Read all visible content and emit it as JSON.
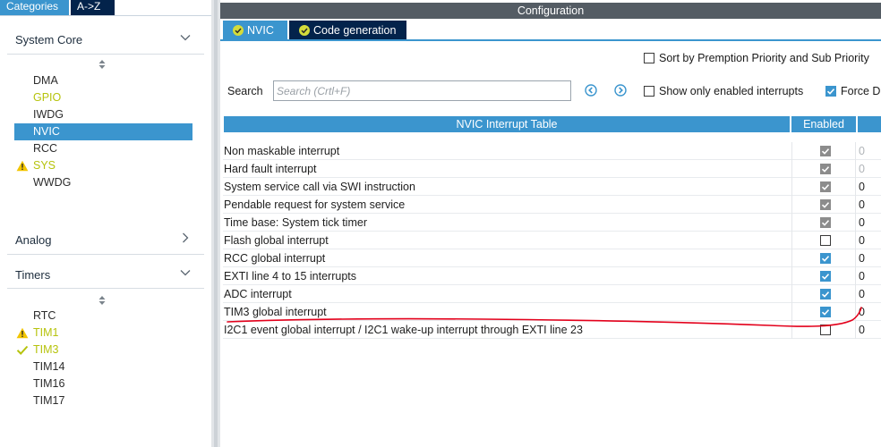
{
  "sidebar": {
    "tabs": {
      "categories": "Categories",
      "az": "A->Z"
    },
    "sections": {
      "system_core": "System Core",
      "analog": "Analog",
      "timers": "Timers"
    },
    "system_core_items": [
      {
        "label": "DMA",
        "state": "none"
      },
      {
        "label": "GPIO",
        "state": "configured"
      },
      {
        "label": "IWDG",
        "state": "none"
      },
      {
        "label": "NVIC",
        "state": "selected"
      },
      {
        "label": "RCC",
        "state": "none"
      },
      {
        "label": "SYS",
        "state": "warning"
      },
      {
        "label": "WWDG",
        "state": "none"
      }
    ],
    "timer_items": [
      {
        "label": "RTC",
        "state": "none"
      },
      {
        "label": "TIM1",
        "state": "warning"
      },
      {
        "label": "TIM3",
        "state": "ok"
      },
      {
        "label": "TIM14",
        "state": "none"
      },
      {
        "label": "TIM16",
        "state": "none"
      },
      {
        "label": "TIM17",
        "state": "none"
      }
    ]
  },
  "main": {
    "title": "Configuration",
    "tabs": {
      "nvic": "NVIC",
      "code_generation": "Code generation"
    },
    "options": {
      "sort_label": "Sort by Premption Priority and Sub Priority",
      "show_enabled_label": "Show only enabled interrupts",
      "force_label": "Force D"
    },
    "search": {
      "label": "Search",
      "placeholder": "Search (Crtl+F)"
    },
    "table": {
      "col_name": "NVIC Interrupt Table",
      "col_enabled": "Enabled",
      "rows": [
        {
          "name": "Non maskable interrupt",
          "enabled": "locked",
          "priority": "0",
          "dim": true
        },
        {
          "name": "Hard fault interrupt",
          "enabled": "locked",
          "priority": "0",
          "dim": true
        },
        {
          "name": "System service call via SWI instruction",
          "enabled": "locked",
          "priority": "0",
          "dim": false
        },
        {
          "name": "Pendable request for system service",
          "enabled": "locked",
          "priority": "0",
          "dim": false
        },
        {
          "name": "Time base: System tick timer",
          "enabled": "locked",
          "priority": "0",
          "dim": false
        },
        {
          "name": "Flash global interrupt",
          "enabled": "off",
          "priority": "0",
          "dim": false
        },
        {
          "name": "RCC global interrupt",
          "enabled": "on",
          "priority": "0",
          "dim": false
        },
        {
          "name": "EXTI line 4 to 15 interrupts",
          "enabled": "on",
          "priority": "0",
          "dim": false
        },
        {
          "name": "ADC interrupt",
          "enabled": "on",
          "priority": "0",
          "dim": false
        },
        {
          "name": "TIM3 global interrupt",
          "enabled": "on",
          "priority": "0",
          "dim": false
        },
        {
          "name": "I2C1 event global interrupt / I2C1 wake-up interrupt through EXTI line 23",
          "enabled": "off",
          "priority": "0",
          "dim": false
        }
      ]
    }
  },
  "colors": {
    "accent": "#3b95ce",
    "dark_tab": "#03234b",
    "config_bar": "#545c64",
    "configured_text": "#b6c30c",
    "warning": "#f2c500",
    "locked_check": "#8c8c8c",
    "annotation": "#e3001b"
  },
  "icons": {
    "collapse": "chevron-down-icon",
    "expand": "chevron-right-icon",
    "warning": "warning-triangle-icon",
    "ok": "checkmark-icon",
    "prev": "circle-arrow-left-icon",
    "next": "circle-arrow-right-icon",
    "sort": "sort-arrows-icon"
  }
}
